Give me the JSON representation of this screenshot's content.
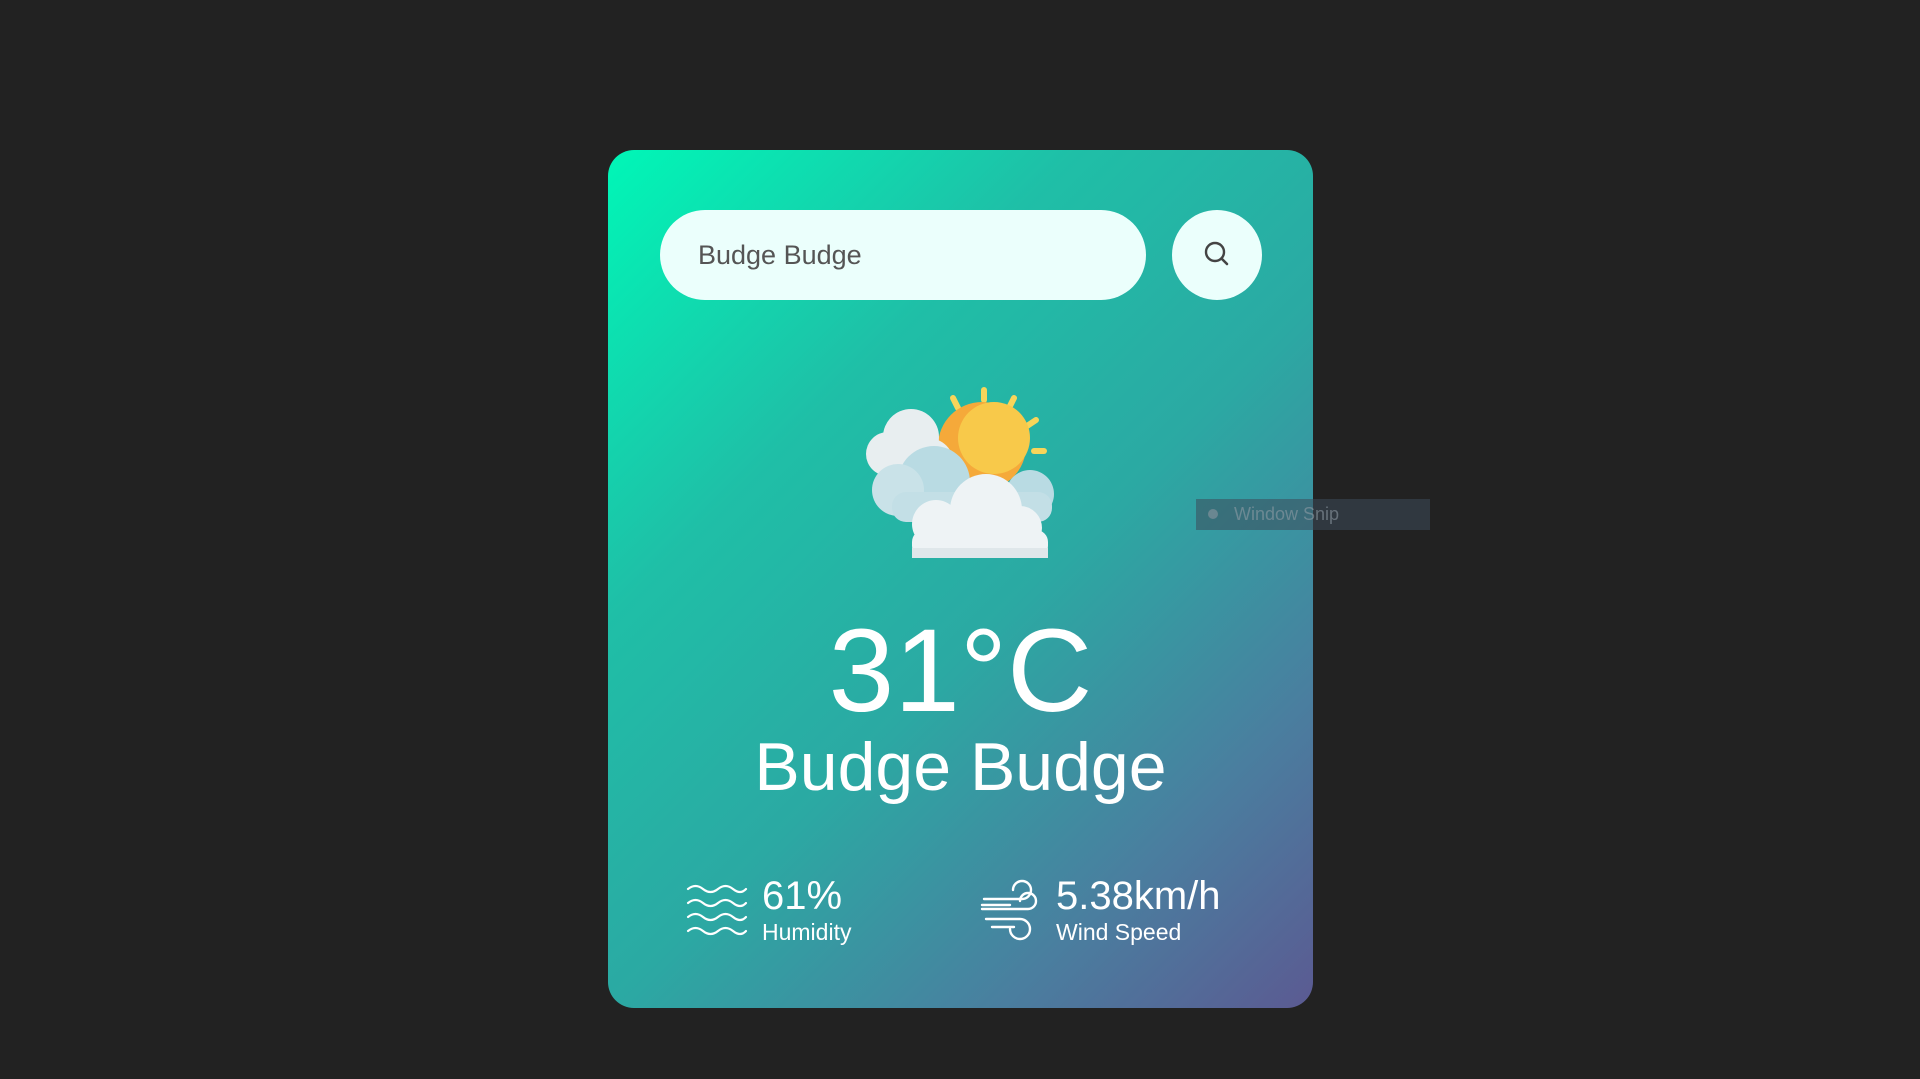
{
  "search": {
    "value": "Budge Budge",
    "button_icon": "search-icon"
  },
  "weather": {
    "icon": "partly-cloudy-sun-icon",
    "temperature": "31°C",
    "city": "Budge Budge"
  },
  "details": {
    "humidity": {
      "icon": "humidity-waves-icon",
      "value": "61%",
      "label": "Humidity"
    },
    "wind": {
      "icon": "wind-icon",
      "value": "5.38km/h",
      "label": "Wind Speed"
    }
  },
  "overlay": {
    "label": "Window Snip"
  },
  "colors": {
    "background": "#222222",
    "card_gradient_start": "#00f7b7",
    "card_gradient_end": "#5b5a92",
    "input_background": "#ebfffc",
    "text": "#ffffff"
  }
}
